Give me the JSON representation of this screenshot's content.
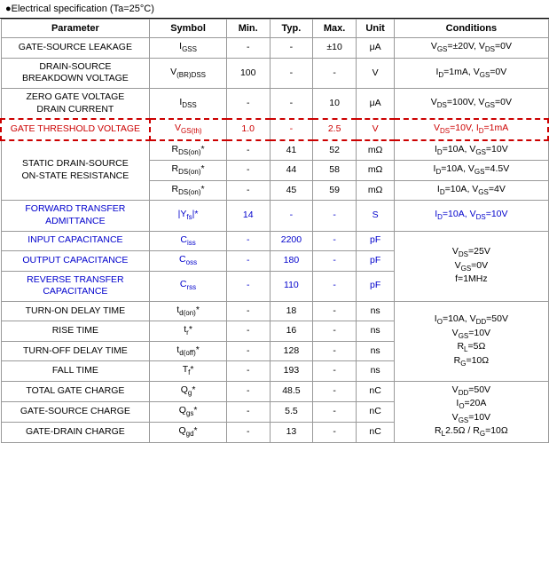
{
  "header": {
    "title": "●Electrical specification (Ta=25°C)"
  },
  "table": {
    "columns": [
      "Parameter",
      "Symbol",
      "Min.",
      "Typ.",
      "Max.",
      "Unit",
      "Conditions"
    ],
    "rows": [
      {
        "param": "GATE-SOURCE LEAKAGE",
        "symbol": "IGSS",
        "min": "-",
        "typ": "-",
        "max": "±10",
        "unit": "μA",
        "cond": "VGS=±20V, VDS=0V",
        "highlight": false,
        "blue": false,
        "rowspan": 1
      },
      {
        "param": "DRAIN-SOURCE\nBREAKDOWN VOLTAGE",
        "symbol": "V(BR)DSS",
        "min": "100",
        "typ": "-",
        "max": "-",
        "unit": "V",
        "cond": "ID=1mA, VGS=0V",
        "highlight": false,
        "blue": false
      },
      {
        "param": "ZERO GATE VOLTAGE\nDRAIN CURRENT",
        "symbol": "IDSS",
        "min": "-",
        "typ": "-",
        "max": "10",
        "unit": "μA",
        "cond": "VDS=100V, VGS=0V",
        "highlight": false,
        "blue": false
      },
      {
        "param": "GATE THRESHOLD VOLTAGE",
        "symbol": "VGS(th)",
        "min": "1.0",
        "typ": "-",
        "max": "2.5",
        "unit": "V",
        "cond": "VDS=10V, ID=1mA",
        "highlight": true,
        "blue": false
      },
      {
        "param": "STATIC DRAIN-SOURCE\nON-STATE RESISTANCE",
        "symbol_rows": [
          "RDS(on)*",
          "RDS(on)*",
          "RDS(on)*"
        ],
        "data_rows": [
          {
            "min": "-",
            "typ": "41",
            "max": "52",
            "unit": "mΩ",
            "cond": "ID=10A, VGS=10V"
          },
          {
            "min": "-",
            "typ": "44",
            "max": "58",
            "unit": "mΩ",
            "cond": "ID=10A, VGS=4.5V"
          },
          {
            "min": "-",
            "typ": "45",
            "max": "59",
            "unit": "mΩ",
            "cond": "ID=10A, VGS=4V"
          }
        ],
        "multi": true,
        "highlight": false,
        "blue": false
      },
      {
        "param": "FORWARD TRANSFER\nADMITTANCE",
        "symbol": "|Yfs|*",
        "min": "14",
        "typ": "-",
        "max": "-",
        "unit": "S",
        "cond": "ID=10A, VDS=10V",
        "highlight": false,
        "blue": true
      },
      {
        "param": "INPUT CAPACITANCE",
        "symbol": "Ciss",
        "min": "-",
        "typ": "2200",
        "max": "-",
        "unit": "pF",
        "cond": "",
        "highlight": false,
        "blue": true,
        "cond_rowspan": true
      },
      {
        "param": "OUTPUT CAPACITANCE",
        "symbol": "Coss",
        "min": "-",
        "typ": "180",
        "max": "-",
        "unit": "pF",
        "cond": "",
        "highlight": false,
        "blue": true,
        "cond_rowspan": true
      },
      {
        "param": "REVERSE TRANSFER\nCAPACITANCE",
        "symbol": "Crss",
        "min": "-",
        "typ": "110",
        "max": "-",
        "unit": "pF",
        "cond": "",
        "highlight": false,
        "blue": true,
        "cond_rowspan": true
      },
      {
        "param": "TURN-ON DELAY TIME",
        "symbol": "td(on)*",
        "min": "-",
        "typ": "18",
        "max": "-",
        "unit": "ns",
        "cond": "",
        "highlight": false,
        "blue": false,
        "switch_group": true
      },
      {
        "param": "RISE TIME",
        "symbol": "tr*",
        "min": "-",
        "typ": "16",
        "max": "-",
        "unit": "ns",
        "cond": "",
        "highlight": false,
        "blue": false,
        "switch_group": true
      },
      {
        "param": "TURN-OFF DELAY TIME",
        "symbol": "td(off)*",
        "min": "-",
        "typ": "128",
        "max": "-",
        "unit": "ns",
        "cond": "",
        "highlight": false,
        "blue": false,
        "switch_group": true
      },
      {
        "param": "FALL TIME",
        "symbol": "Tf*",
        "min": "-",
        "typ": "193",
        "max": "-",
        "unit": "ns",
        "cond": "",
        "highlight": false,
        "blue": false,
        "switch_group": true
      },
      {
        "param": "TOTAL GATE CHARGE",
        "symbol": "Qg*",
        "min": "-",
        "typ": "48.5",
        "max": "-",
        "unit": "nC",
        "cond": "",
        "highlight": false,
        "blue": false,
        "charge_group": true
      },
      {
        "param": "GATE-SOURCE CHARGE",
        "symbol": "Qgs*",
        "min": "-",
        "typ": "5.5",
        "max": "-",
        "unit": "nC",
        "cond": "",
        "highlight": false,
        "blue": false,
        "charge_group": true
      },
      {
        "param": "GATE-DRAIN CHARGE",
        "symbol": "Qgd*",
        "min": "-",
        "typ": "13",
        "max": "-",
        "unit": "nC",
        "cond": "",
        "highlight": false,
        "blue": false,
        "charge_group": true
      }
    ]
  }
}
